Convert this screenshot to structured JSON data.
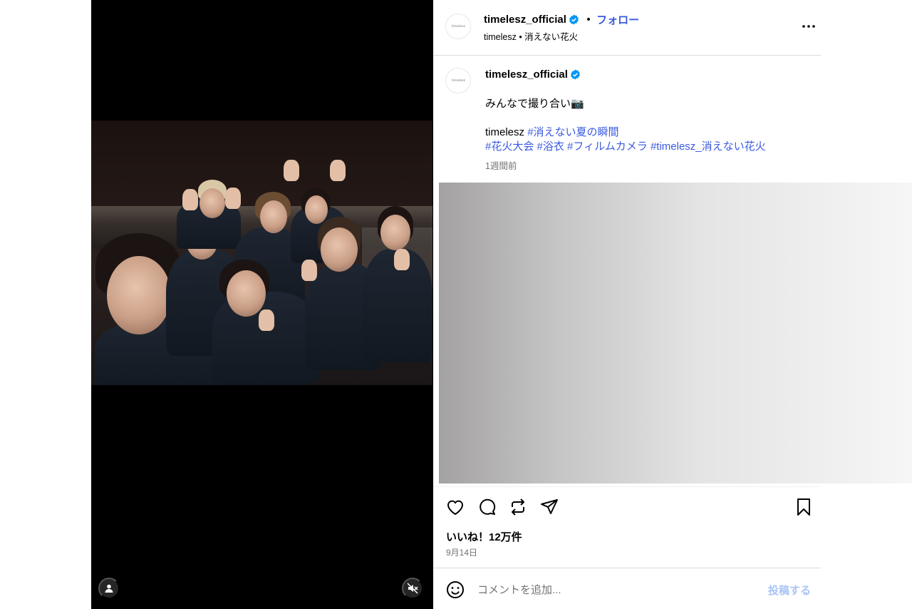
{
  "post": {
    "username": "timelesz_official",
    "avatar_logo": "timelesz",
    "follow_label": "フォロー",
    "subtitle": "timelesz • 消えない花火",
    "caption_line1": "みんなで撮り合い📷",
    "caption_prefix": "timelesz",
    "hashtags_line1": "#消えない夏の瞬間",
    "hashtags_line2": [
      "#花火大会",
      "#浴衣",
      "#フィルムカメラ",
      "#timelesz_消えない花火"
    ],
    "time_ago": "1週間前",
    "likes": "いいね！12万件",
    "date": "9月14日"
  },
  "comment": {
    "placeholder": "コメントを追加...",
    "post_label": "投稿する"
  },
  "icons": {
    "verified": "verified-badge-icon",
    "more": "more-options-icon",
    "like": "heart-icon",
    "comment": "comment-bubble-icon",
    "repost": "repost-icon",
    "share": "send-icon",
    "save": "bookmark-icon",
    "emoji": "smiley-icon",
    "user_tag": "user-icon",
    "mute": "muted-speaker-icon"
  },
  "colors": {
    "link": "#3a5ae0",
    "verified": "#0095f6",
    "muted_text": "#737373",
    "disabled_post": "#a9c4f5"
  }
}
